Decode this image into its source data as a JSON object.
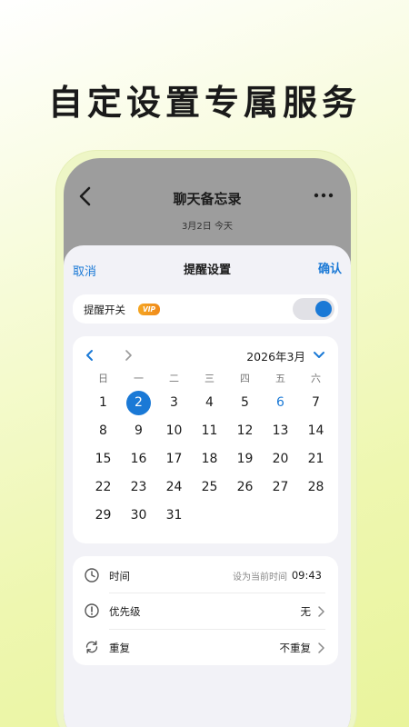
{
  "headline": "自定设置专属服务",
  "chat": {
    "title": "聊天备忘录",
    "date": "3月2日 今天"
  },
  "sheet": {
    "cancel": "取消",
    "title": "提醒设置",
    "confirm": "确认"
  },
  "reminder_switch": {
    "label": "提醒开关",
    "badge": "VIP",
    "on": true
  },
  "calendar": {
    "month_label": "2026年3月",
    "weekdays": [
      "日",
      "一",
      "二",
      "三",
      "四",
      "五",
      "六"
    ],
    "weeks": [
      [
        "1",
        "2",
        "3",
        "4",
        "5",
        "6",
        "7"
      ],
      [
        "8",
        "9",
        "10",
        "11",
        "12",
        "13",
        "14"
      ],
      [
        "15",
        "16",
        "17",
        "18",
        "19",
        "20",
        "21"
      ],
      [
        "22",
        "23",
        "24",
        "25",
        "26",
        "27",
        "28"
      ],
      [
        "29",
        "30",
        "31",
        "",
        "",
        "",
        ""
      ]
    ],
    "selected_day": "2",
    "highlight_day": "6"
  },
  "options": {
    "time": {
      "label": "时间",
      "hint": "设为当前时间",
      "value": "09:43"
    },
    "priority": {
      "label": "优先级",
      "value": "无"
    },
    "repeat": {
      "label": "重复",
      "value": "不重复"
    }
  },
  "colors": {
    "accent": "#1a79d6",
    "badge": "#f5a623"
  }
}
